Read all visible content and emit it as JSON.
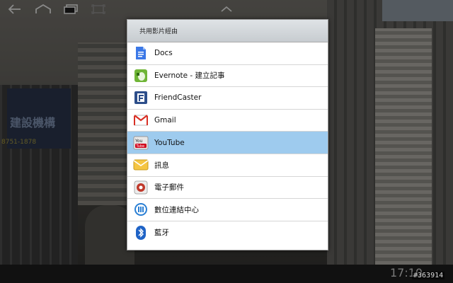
{
  "dialog": {
    "title": "共用影片經由",
    "items": [
      {
        "label": "Docs",
        "icon": "docs-icon",
        "selected": false
      },
      {
        "label": "Evernote - 建立記事",
        "icon": "evernote-icon",
        "selected": false
      },
      {
        "label": "FriendCaster",
        "icon": "friendcaster-icon",
        "selected": false
      },
      {
        "label": "Gmail",
        "icon": "gmail-icon",
        "selected": false
      },
      {
        "label": "YouTube",
        "icon": "youtube-icon",
        "selected": true
      },
      {
        "label": "訊息",
        "icon": "messaging-icon",
        "selected": false
      },
      {
        "label": "電子郵件",
        "icon": "email-icon",
        "selected": false
      },
      {
        "label": "數位連結中心",
        "icon": "digital-hub-icon",
        "selected": false
      },
      {
        "label": "藍牙",
        "icon": "bluetooth-icon",
        "selected": false
      }
    ]
  },
  "statusbar": {
    "clock": "17:10"
  },
  "background_text": {
    "sign": "建設機構",
    "phone": "8751-1878"
  },
  "watermark": "#363914",
  "colors": {
    "selected": "#9ecbee",
    "header": "#d3d8db",
    "navbar": "#111111"
  }
}
